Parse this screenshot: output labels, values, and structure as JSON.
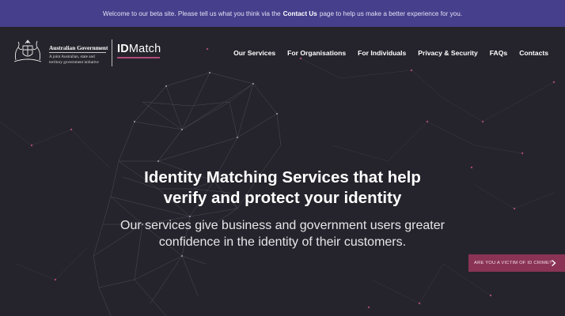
{
  "beta_banner": {
    "text_before": "Welcome to our beta site. Please tell us what you think via the",
    "link": "Contact Us",
    "text_after": "page to help us make a better experience for you."
  },
  "branding": {
    "gov_title": "Australian Government",
    "gov_sub_line1": "A joint Australian, state and",
    "gov_sub_line2": "territory government initiative",
    "logo_id": "ID",
    "logo_match": "Match"
  },
  "nav": {
    "items": [
      {
        "label": "Our Services"
      },
      {
        "label": "For Organisations"
      },
      {
        "label": "For Individuals"
      },
      {
        "label": "Privacy & Security"
      },
      {
        "label": "FAQs"
      },
      {
        "label": "Contacts"
      }
    ]
  },
  "hero": {
    "title_line1": "Identity Matching Services that help",
    "title_line2": "verify and protect your identity",
    "subtitle_line1": "Our services give business and government users greater",
    "subtitle_line2": "confidence in the identity of their customers."
  },
  "victim_button": {
    "label": "ARE YOU A VICTIM OF ID CRIME?"
  },
  "colors": {
    "background": "#25242c",
    "beta_bar": "#463f8c",
    "accent": "#8a3355",
    "logo_underline": "#b04a7a"
  },
  "icons": {
    "crest": "coat-of-arms-icon",
    "victim_chevron": "chevron-right-icon"
  }
}
